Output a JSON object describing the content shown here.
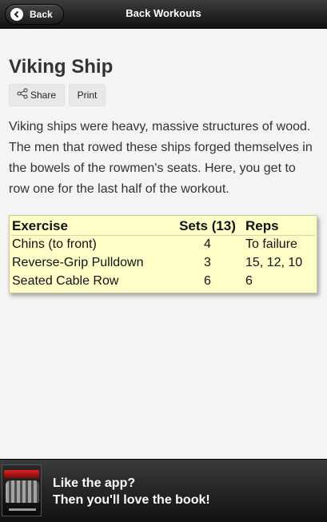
{
  "header": {
    "back_label": "Back",
    "title": "Back Workouts"
  },
  "page": {
    "title": "Viking Ship",
    "share_label": "Share",
    "print_label": "Print",
    "description": "Viking ships were heavy, massive structures of wood. The men that rowed these ships forged themselves in the bowels of the rowmen's seats. Here, you get to row one for the last half of the workout."
  },
  "table": {
    "headers": [
      "Exercise",
      "Sets (13)",
      "Reps"
    ],
    "rows": [
      [
        "Chins (to front)",
        "4",
        "To failure"
      ],
      [
        "Reverse-Grip Pulldown",
        "3",
        "15, 12, 10"
      ],
      [
        "Seated Cable Row",
        "6",
        "6"
      ]
    ]
  },
  "footer": {
    "line1": "Like the app?",
    "line2": "Then you'll love the book!"
  },
  "icons": {
    "back": "chevron-left-icon",
    "share": "share-icon"
  }
}
